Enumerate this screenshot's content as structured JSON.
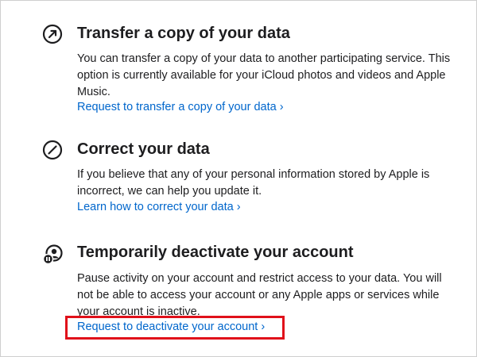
{
  "sections": [
    {
      "icon": "arrow-up-right-circle-icon",
      "title": "Transfer a copy of your data",
      "description": "You can transfer a copy of your data to another participating service. This option is currently available for your iCloud photos and videos and Apple Music.",
      "link": "Request to transfer a copy of your data ›"
    },
    {
      "icon": "slash-circle-icon",
      "title": "Correct your data",
      "description": "If you believe that any of your personal information stored by Apple is incorrect, we can help you update it.",
      "link": "Learn how to correct your data ›"
    },
    {
      "icon": "person-pause-icon",
      "title": "Temporarily deactivate your account",
      "description": "Pause activity on your account and restrict access to your data. You will not be able to access your account or any Apple apps or services while your account is inactive.",
      "link": "Request to deactivate your account ›"
    }
  ],
  "colors": {
    "link": "#0066cc",
    "text": "#1d1d1f",
    "highlight": "#e0101a"
  }
}
